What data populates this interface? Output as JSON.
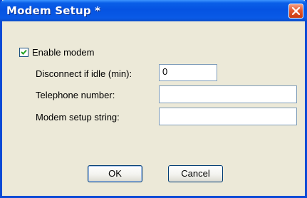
{
  "window": {
    "title": "Modem Setup *"
  },
  "enable_modem": {
    "label": "Enable modem",
    "checked": true
  },
  "fields": {
    "idle": {
      "label": "Disconnect if idle (min):",
      "value": "0"
    },
    "phone": {
      "label": "Telephone number:",
      "value": ""
    },
    "setup": {
      "label": "Modem setup string:",
      "value": ""
    }
  },
  "buttons": {
    "ok": "OK",
    "cancel": "Cancel"
  },
  "icons": {
    "close": "close-icon",
    "check": "checkmark-icon"
  },
  "colors": {
    "titlebar": "#0553e2",
    "close_button": "#e2582f",
    "dialog_bg": "#ece9d8",
    "checkmark": "#21a121"
  }
}
